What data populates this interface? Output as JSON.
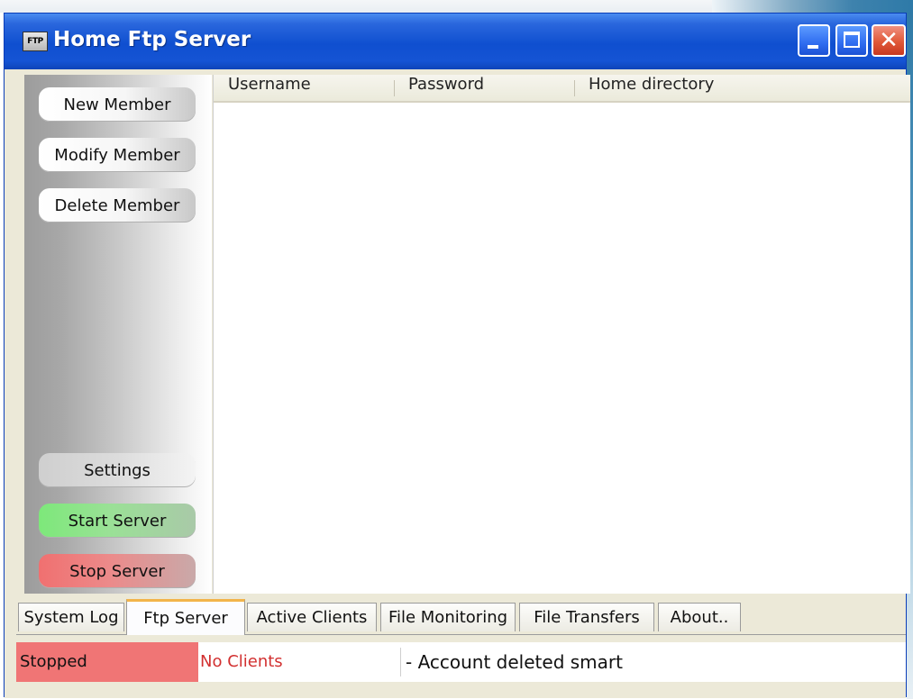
{
  "window": {
    "title": "Home Ftp Server",
    "app_icon_label": "FTP",
    "controls": {
      "minimize": "minimize",
      "maximize": "maximize",
      "close": "✕"
    }
  },
  "sidebar": {
    "top_buttons": [
      "New Member",
      "Modify Member",
      "Delete Member"
    ],
    "settings": "Settings",
    "start": "Start Server",
    "stop": "Stop Server"
  },
  "listview": {
    "columns": [
      "Username",
      "Password",
      "Home directory"
    ],
    "rows": []
  },
  "tabs": {
    "items": [
      "System Log",
      "Ftp Server",
      "Active Clients",
      "File Monitoring",
      "File Transfers",
      "About.."
    ],
    "active": "Ftp Server"
  },
  "status": {
    "server_state": "Stopped",
    "clients": "No Clients",
    "message": "- Account deleted smart"
  },
  "colors": {
    "stopped": "#f07575",
    "no_clients_text": "#d23030",
    "start_green": "#7de87a",
    "stop_red": "#f07070",
    "active_tab_accent": "#f2b44a"
  }
}
